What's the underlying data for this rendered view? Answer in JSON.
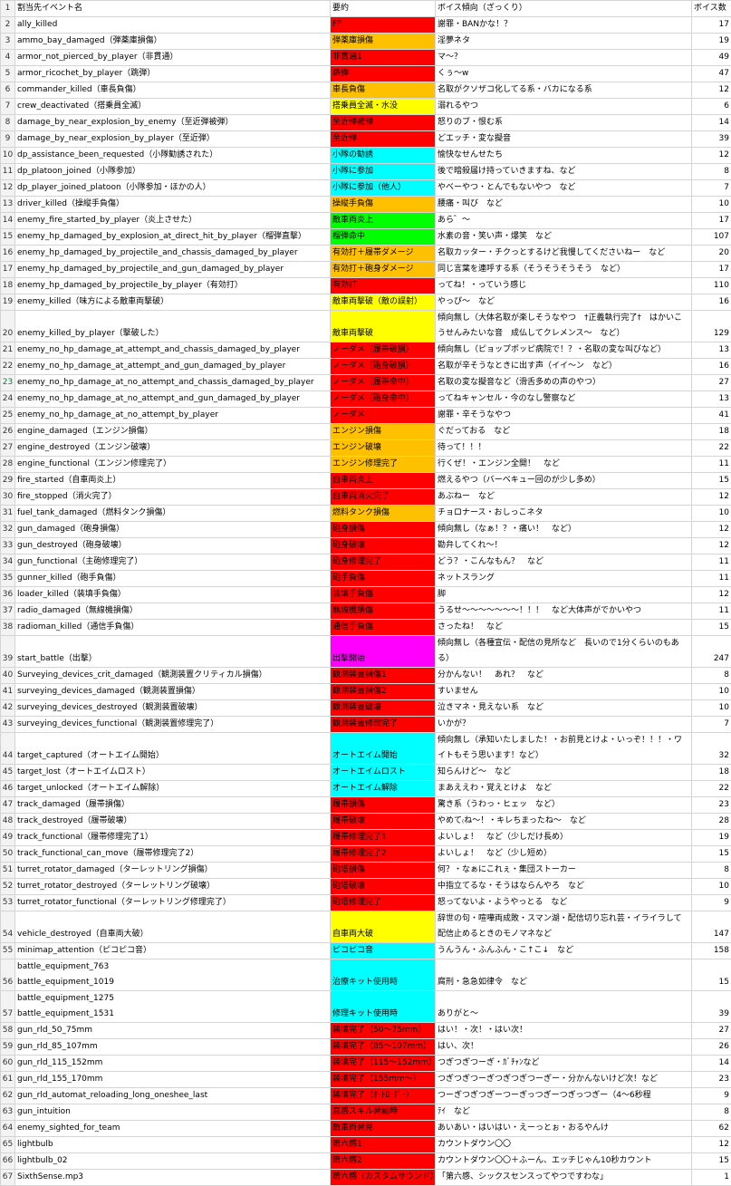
{
  "colors": {
    "red": "#ff0000",
    "orange": "#ffc000",
    "yellow": "#ffff00",
    "green": "#00ff00",
    "cyan": "#00ffff",
    "magenta": "#ff00ff"
  },
  "header": {
    "rownum": "1",
    "col_event": "割当先イベント名",
    "col_summary": "要約",
    "col_trend": "ボイス傾向（ざっくり）",
    "col_count": "ボイス数"
  },
  "rows": [
    {
      "n": "2",
      "e": "ally_killed",
      "s": "FF",
      "c": "red",
      "t": "謝罪・BANかな！？",
      "v": "17"
    },
    {
      "n": "3",
      "e": "ammo_bay_damaged（弾薬庫損傷）",
      "s": "弾薬庫損傷",
      "c": "orange",
      "t": "淫夢ネタ",
      "v": "19"
    },
    {
      "n": "4",
      "e": "armor_not_pierced_by_player（非貫通）",
      "s": "非貫通1",
      "c": "red",
      "t": "マ～？",
      "v": "49"
    },
    {
      "n": "5",
      "e": "armor_ricochet_by_player（跳弾）",
      "s": "跳弾",
      "c": "red",
      "t": "くぅ～w",
      "v": "47"
    },
    {
      "n": "6",
      "e": "commander_killed（車長負傷）",
      "s": "車長負傷",
      "c": "orange",
      "t": "名取がクソザコ化してる系・バカになる系",
      "v": "12"
    },
    {
      "n": "7",
      "e": "crew_deactivated（搭乗員全滅）",
      "s": "搭乗員全滅・水没",
      "c": "yellow",
      "t": "溺れるやつ",
      "v": "6"
    },
    {
      "n": "8",
      "e": "damage_by_near_explosion_by_enemy（至近弾被弾）",
      "s": "至近弾被弾",
      "c": "red",
      "t": "怒りのブ・恨む系",
      "v": "14"
    },
    {
      "n": "9",
      "e": "damage_by_near_explosion_by_player（至近弾）",
      "s": "至近弾",
      "c": "red",
      "t": "どエッチ・変な擬音",
      "v": "39"
    },
    {
      "n": "10",
      "e": "dp_assistance_been_requested（小隊勧誘された）",
      "s": "小隊の勧誘",
      "c": "cyan",
      "t": "愉快なせんせたち",
      "v": "12"
    },
    {
      "n": "11",
      "e": "dp_platoon_joined（小隊参加）",
      "s": "小隊に参加",
      "c": "cyan",
      "t": "後で暗殺届け持っていきますね、など",
      "v": "8"
    },
    {
      "n": "12",
      "e": "dp_player_joined_platoon（小隊参加・ほかの人）",
      "s": "小隊に参加（他人）",
      "c": "cyan",
      "t": "やべーやつ・とんでもないやつ　など",
      "v": "7"
    },
    {
      "n": "13",
      "e": "driver_killed（操縦手負傷）",
      "s": "操縦手負傷",
      "c": "orange",
      "t": "腰痛・叫び　など",
      "v": "10"
    },
    {
      "n": "14",
      "e": "enemy_fire_started_by_player（炎上させた）",
      "s": "敵車両炎上",
      "c": "green",
      "t": "あら゛～",
      "v": "17"
    },
    {
      "n": "15",
      "e": "enemy_hp_damaged_by_explosion_at_direct_hit_by_player（榴弾直撃）",
      "s": "榴弾命中",
      "c": "green",
      "t": "水素の音・笑い声・爆笑　など",
      "v": "107"
    },
    {
      "n": "16",
      "e": "enemy_hp_damaged_by_projectile_and_chassis_damaged_by_player",
      "s": "有効打＋履帯ダメージ",
      "c": "orange",
      "t": "名取カッター・チクっとするけど我慢してくださいねー　など",
      "v": "20"
    },
    {
      "n": "17",
      "e": "enemy_hp_damaged_by_projectile_and_gun_damaged_by_player",
      "s": "有効打＋砲身ダメージ",
      "c": "orange",
      "t": "同じ言葉を連呼する系（そうそうそうそう　など）",
      "v": "17"
    },
    {
      "n": "18",
      "e": "enemy_hp_damaged_by_projectile_by_player（有効打）",
      "s": "有効打",
      "c": "red",
      "t": "ってね！・っていう感じ",
      "v": "110"
    },
    {
      "n": "19",
      "e": "enemy_killed（味方による敵車両撃破）",
      "s": "敵車両撃破（敵の誤射）",
      "c": "yellow",
      "t": "やっぴ～　など",
      "v": "16"
    },
    {
      "n": "20",
      "e": "enemy_killed_by_player（撃破した）",
      "s": "敵車両撃破",
      "c": "yellow",
      "t": "傾向無し（大体名取が楽しそうなやつ　†正義執行完了†　はかいこうせんみたいな音　成仏してクレメンス～　など）",
      "v": "129",
      "tall": true
    },
    {
      "n": "21",
      "e": "enemy_no_hp_damage_at_attempt_and_chassis_damaged_by_player",
      "s": "ノーダメ（履帯破損）",
      "c": "red",
      "t": "傾向無し（ピョップポッピ病院で！？・名取の変な叫びなど）",
      "v": "13"
    },
    {
      "n": "22",
      "e": "enemy_no_hp_damage_at_attempt_and_gun_damaged_by_player",
      "s": "ノーダメ（砲身破損）",
      "c": "red",
      "t": "名取が辛そうなときに出す声（イイ～ン　など）",
      "v": "16"
    },
    {
      "n": "23",
      "e": "enemy_no_hp_damage_at_no_attempt_and_chassis_damaged_by_player",
      "s": "ノーダメ（履帯命中）",
      "c": "red",
      "t": "名取の変な擬音など（滑舌多めの声のやつ）",
      "v": "27",
      "sel": true
    },
    {
      "n": "24",
      "e": "enemy_no_hp_damage_at_no_attempt_and_gun_damaged_by_player",
      "s": "ノーダメ（砲身命中）",
      "c": "red",
      "t": "ってねキャンセル・今のなし警察など",
      "v": "13"
    },
    {
      "n": "25",
      "e": "enemy_no_hp_damage_at_no_attempt_by_player",
      "s": "ノーダメ",
      "c": "red",
      "t": "謝罪・辛そうなやつ",
      "v": "41"
    },
    {
      "n": "26",
      "e": "engine_damaged（エンジン損傷）",
      "s": "エンジン損傷",
      "c": "orange",
      "t": "ぐだっておる　など",
      "v": "18"
    },
    {
      "n": "27",
      "e": "engine_destroyed（エンジン破壊）",
      "s": "エンジン破壊",
      "c": "orange",
      "t": "待って！！！",
      "v": "22"
    },
    {
      "n": "28",
      "e": "engine_functional（エンジン修理完了）",
      "s": "エンジン修理完了",
      "c": "orange",
      "t": "行くぜ！・エンジン全開！　など",
      "v": "11"
    },
    {
      "n": "29",
      "e": "fire_started（自車両炎上）",
      "s": "自車両炎上",
      "c": "red",
      "t": "燃えるやつ（バーベキュー回のが少し多め）",
      "v": "15"
    },
    {
      "n": "30",
      "e": "fire_stopped（消火完了）",
      "s": "自車両消火完了",
      "c": "red",
      "t": "あぶねー　など",
      "v": "12"
    },
    {
      "n": "31",
      "e": "fuel_tank_damaged（燃料タンク損傷）",
      "s": "燃料タンク損傷",
      "c": "orange",
      "t": "チョロナース・おしっこネタ",
      "v": "10"
    },
    {
      "n": "32",
      "e": "gun_damaged（砲身損傷）",
      "s": "砲身損傷",
      "c": "red",
      "t": "傾向無し（なぁ！？・痛い！　など）",
      "v": "12"
    },
    {
      "n": "33",
      "e": "gun_destroyed（砲身破壊）",
      "s": "砲身破壊",
      "c": "red",
      "t": "勘弁してくれ～！",
      "v": "12"
    },
    {
      "n": "34",
      "e": "gun_functional（主砲修理完了）",
      "s": "砲身修理完了",
      "c": "red",
      "t": "どう？・こんなもん？　など",
      "v": "11"
    },
    {
      "n": "35",
      "e": "gunner_killed（砲手負傷）",
      "s": "砲手負傷",
      "c": "red",
      "t": "ネットスラング",
      "v": "11"
    },
    {
      "n": "36",
      "e": "loader_killed（装填手負傷）",
      "s": "装填手負傷",
      "c": "red",
      "t": "脚",
      "v": "12"
    },
    {
      "n": "37",
      "e": "radio_damaged（無線機損傷）",
      "s": "無線機損傷",
      "c": "red",
      "t": "うるせ～～～～～～～！！！　など大体声がでかいやつ",
      "v": "11"
    },
    {
      "n": "38",
      "e": "radioman_killed（通信手負傷）",
      "s": "通信手負傷",
      "c": "red",
      "t": "さったね！　など",
      "v": "15"
    },
    {
      "n": "39",
      "e": "start_battle（出撃）",
      "s": "出撃開始",
      "c": "magenta",
      "t": "傾向無し（各種宣伝・配信の見所など　長いので1分くらいのもある）",
      "v": "247",
      "tall": true
    },
    {
      "n": "40",
      "e": "Surveying_devices_crit_damaged（観測装置クリティカル損傷）",
      "s": "観測装置損傷1",
      "c": "red",
      "t": "分かんない！　あれ？　など",
      "v": "8"
    },
    {
      "n": "41",
      "e": "surveying_devices_damaged（観測装置損傷）",
      "s": "観測装置損傷2",
      "c": "red",
      "t": "すいません",
      "v": "10"
    },
    {
      "n": "42",
      "e": "surveying_devices_destroyed（観測装置破壊）",
      "s": "観測装置破壊",
      "c": "red",
      "t": "泣きマネ・見えない系　など",
      "v": "10"
    },
    {
      "n": "43",
      "e": "surveying_devices_functional（観測装置修理完了）",
      "s": "観測装置修理完了",
      "c": "red",
      "t": "いかが？",
      "v": "7"
    },
    {
      "n": "44",
      "e": "target_captured（オートエイム開始）",
      "s": "オートエイム開始",
      "c": "cyan",
      "t": "傾向無し（承知いたしました！・お前見とけよ・いっぞ！！！・ワイトもそう思います！など）",
      "v": "32",
      "tall": true
    },
    {
      "n": "45",
      "e": "target_lost（オートエイムロスト）",
      "s": "オートエイムロスト",
      "c": "cyan",
      "t": "知らんけど～　など",
      "v": "18"
    },
    {
      "n": "46",
      "e": "target_unlocked（オートエイム解除）",
      "s": "オートエイム解除",
      "c": "cyan",
      "t": "まあええわ・覚えとけよ　など",
      "v": "22"
    },
    {
      "n": "47",
      "e": "track_damaged（履帯損傷）",
      "s": "履帯損傷",
      "c": "red",
      "t": "驚き系（うわっ・ヒェッ　など）",
      "v": "23"
    },
    {
      "n": "48",
      "e": "track_destroyed（履帯破壊）",
      "s": "履帯破壊",
      "c": "red",
      "t": "やめて₍ね～！・キレちまったね～　など",
      "v": "28"
    },
    {
      "n": "49",
      "e": "track_functional（履帯修理完了1）",
      "s": "履帯修理完了1",
      "c": "red",
      "t": "よいしょ！　など（少しだけ長め）",
      "v": "19"
    },
    {
      "n": "50",
      "e": "track_functional_can_move（履帯修理完了2）",
      "s": "履帯修理完了2",
      "c": "red",
      "t": "よいしょ！　など（少し短め）",
      "v": "15"
    },
    {
      "n": "51",
      "e": "turret_rotator_damaged（ターレットリング損傷）",
      "s": "砲塔損傷",
      "c": "red",
      "t": "何？・なぁにこれぇ・集団ストーカー",
      "v": "8"
    },
    {
      "n": "52",
      "e": "turret_rotator_destroyed（ターレットリング破壊）",
      "s": "砲塔破壊",
      "c": "red",
      "t": "中指立てるな・そうはならんやろ　など",
      "v": "10"
    },
    {
      "n": "53",
      "e": "turret_rotator_functional（ターレットリング修理完了）",
      "s": "砲塔修理完了",
      "c": "red",
      "t": "怒ってないよ・ようやっとる　など",
      "v": "9"
    },
    {
      "n": "54",
      "e": "vehicle_destroyed（自車両大破）",
      "s": "自車両大破",
      "c": "yellow",
      "t": "辞世の句・喧嘩両成敗・スマン湖・配信切り忘れ芸・イライラして配信止めるときのモノマネなど",
      "v": "147",
      "tall": true
    },
    {
      "n": "55",
      "e": "minimap_attention（ピコピコ音）",
      "s": "ピコピコ音",
      "c": "cyan",
      "t": "うんうん・ふんふん・こ↑こ↓　など",
      "v": "158"
    },
    {
      "n": "56",
      "e": "battle_equipment_763\nbattle_equipment_1019",
      "s": "治療キット使用時",
      "c": "cyan",
      "t": "腐刑・急急如律令　など",
      "v": "15",
      "tall": true
    },
    {
      "n": "57",
      "e": "battle_equipment_1275\nbattle_equipment_1531",
      "s": "修理キット使用時",
      "c": "cyan",
      "t": "ありがと～",
      "v": "39",
      "tall": true
    },
    {
      "n": "58",
      "e": "gun_rld_50_75mm",
      "s": "装填完了（50～75mm）",
      "c": "red",
      "t": "はい！・次！・はい次！",
      "v": "27"
    },
    {
      "n": "59",
      "e": "gun_rld_85_107mm",
      "s": "装填完了（85～107mm）",
      "c": "red",
      "t": "はい、次！",
      "v": "26"
    },
    {
      "n": "60",
      "e": "gun_rld_115_152mm",
      "s": "装填完了（115～152mm）",
      "c": "red",
      "t": "つぎつぎつーぎ・ｶﾞﾁｬﾝなど",
      "v": "14"
    },
    {
      "n": "61",
      "e": "gun_rld_155_170mm",
      "s": "装填完了（155mm～）",
      "c": "red",
      "t": "つぎつぎつーぎつぎつぎつーぎー・分かんないけど次！など",
      "v": "23"
    },
    {
      "n": "62",
      "e": "gun_rld_automat_reloading_long_oneshee_last",
      "s": "装填完了（ｵｰﾄﾛｰﾀﾞｰ）",
      "c": "red",
      "t": "つーぎつぎつぎーつーぎっつぎーつぎっつぎー（4～6秒程",
      "v": "9"
    },
    {
      "n": "63",
      "e": "gun_intuition",
      "s": "直感スキル発動時",
      "c": "red",
      "t": "ﾃｲ　など",
      "v": "8"
    },
    {
      "n": "64",
      "e": "enemy_sighted_for_team",
      "s": "敵車両発見",
      "c": "red",
      "t": "あいあい・はいはい・えーっとぉ・おるやんけ",
      "v": "62"
    },
    {
      "n": "65",
      "e": "lightbulb",
      "s": "第六感1",
      "c": "red",
      "t": "カウントダウン〇〇",
      "v": "12"
    },
    {
      "n": "66",
      "e": "lightbulb_02",
      "s": "第六感2",
      "c": "red",
      "t": "カウントダウン〇〇＋ふーん、エッチじゃん10秒カウント",
      "v": "15"
    },
    {
      "n": "67",
      "e": "SixthSense.mp3",
      "s": "第六感（カスタムサウンド）",
      "c": "red",
      "t": "「第六感、シックスセンスってやつですわな」",
      "v": "1"
    }
  ]
}
